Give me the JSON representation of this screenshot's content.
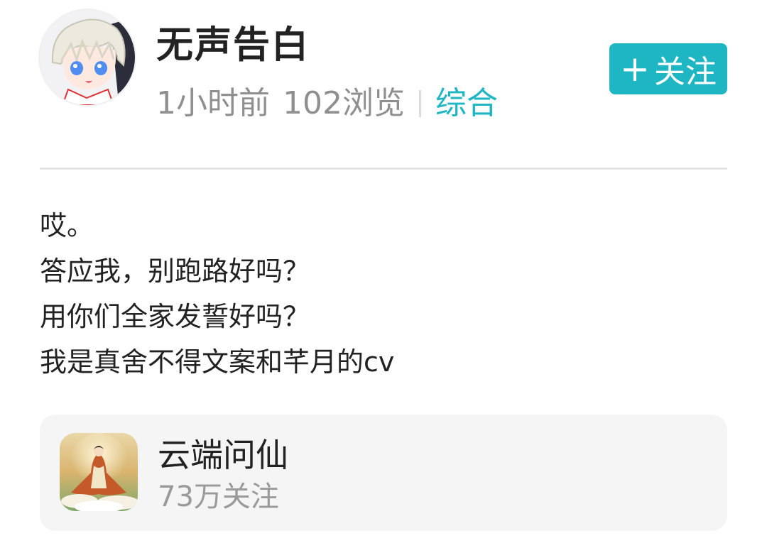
{
  "post": {
    "author": {
      "name": "无声告白",
      "avatar_icon": "anime-avatar"
    },
    "meta": {
      "time": "1小时前",
      "views": "102浏览",
      "category": "综合"
    },
    "follow_button": {
      "icon": "+",
      "label": "关注"
    },
    "content_lines": [
      "哎。",
      "答应我，别跑路好吗？",
      "用你们全家发誓好吗？",
      "我是真舍不得文案和芊月的cv"
    ]
  },
  "game_card": {
    "title": "云端问仙",
    "followers": "73万关注",
    "icon": "game-icon"
  },
  "colors": {
    "accent": "#1fb6c4",
    "meta_gray": "#8f8f8f",
    "card_bg": "#f5f5f5"
  }
}
